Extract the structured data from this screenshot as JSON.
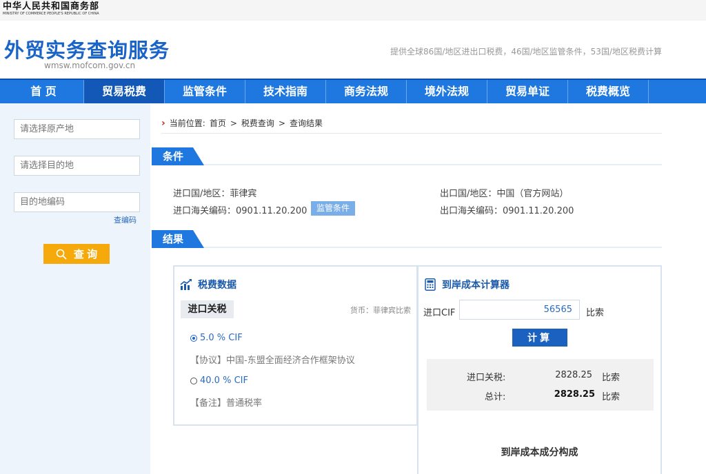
{
  "ministry": {
    "name_cn": "中华人民共和国商务部",
    "name_en": "MINISTRY OF COMMERCE PEOPLE'S REPUBLIC OF CHINA"
  },
  "header": {
    "title": "外贸实务查询服务",
    "url": "wmsw.mofcom.gov.cn",
    "description": "提供全球86国/地区进出口税费，46国/地区监管条件，53国/地区税费计算"
  },
  "nav": {
    "items": [
      {
        "label": "首 页"
      },
      {
        "label": "贸易税费",
        "active": true
      },
      {
        "label": "监管条件"
      },
      {
        "label": "技术指南"
      },
      {
        "label": "商务法规"
      },
      {
        "label": "境外法规"
      },
      {
        "label": "贸易单证"
      },
      {
        "label": "税费概览"
      }
    ]
  },
  "sidebar": {
    "origin_placeholder": "请选择原产地",
    "destination_placeholder": "请选择目的地",
    "code_placeholder": "目的地编码",
    "code_link": "查编码",
    "query_button": "查 询"
  },
  "breadcrumb": {
    "prefix": "当前位置:",
    "home": "首页",
    "sep1": ">",
    "tax_query": "税费查询",
    "sep2": ">",
    "current": "查询结果"
  },
  "conditions": {
    "heading": "条件",
    "import_country": "进口国/地区：菲律宾",
    "import_code": "进口海关编码：0901.11.20.200",
    "supervision_button": "监管条件",
    "export_country": "出口国/地区：中国（官方网站）",
    "export_code": "出口海关编码：0901.11.20.200"
  },
  "results": {
    "heading": "结果",
    "tax_panel": {
      "title": "税费数据",
      "tag": "进口关税",
      "currency": "货币：菲律宾比索",
      "options": [
        {
          "label": "5.0 % CIF",
          "selected": true,
          "note": "【协议】中国-东盟全面经济合作框架协议"
        },
        {
          "label": "40.0 % CIF",
          "selected": false,
          "note": "【备注】普通税率"
        }
      ]
    },
    "calculator": {
      "title": "到岸成本计算器",
      "cif_label": "进口CIF",
      "cif_value": "56565",
      "cif_unit": "比索",
      "calc_button": "计算",
      "import_duty_label": "进口关税:",
      "import_duty_value": "2828.25",
      "import_duty_unit": "比索",
      "total_label": "总计:",
      "total_value": "2828.25",
      "total_unit": "比索",
      "composition_title": "到岸成本成分构成"
    }
  }
}
